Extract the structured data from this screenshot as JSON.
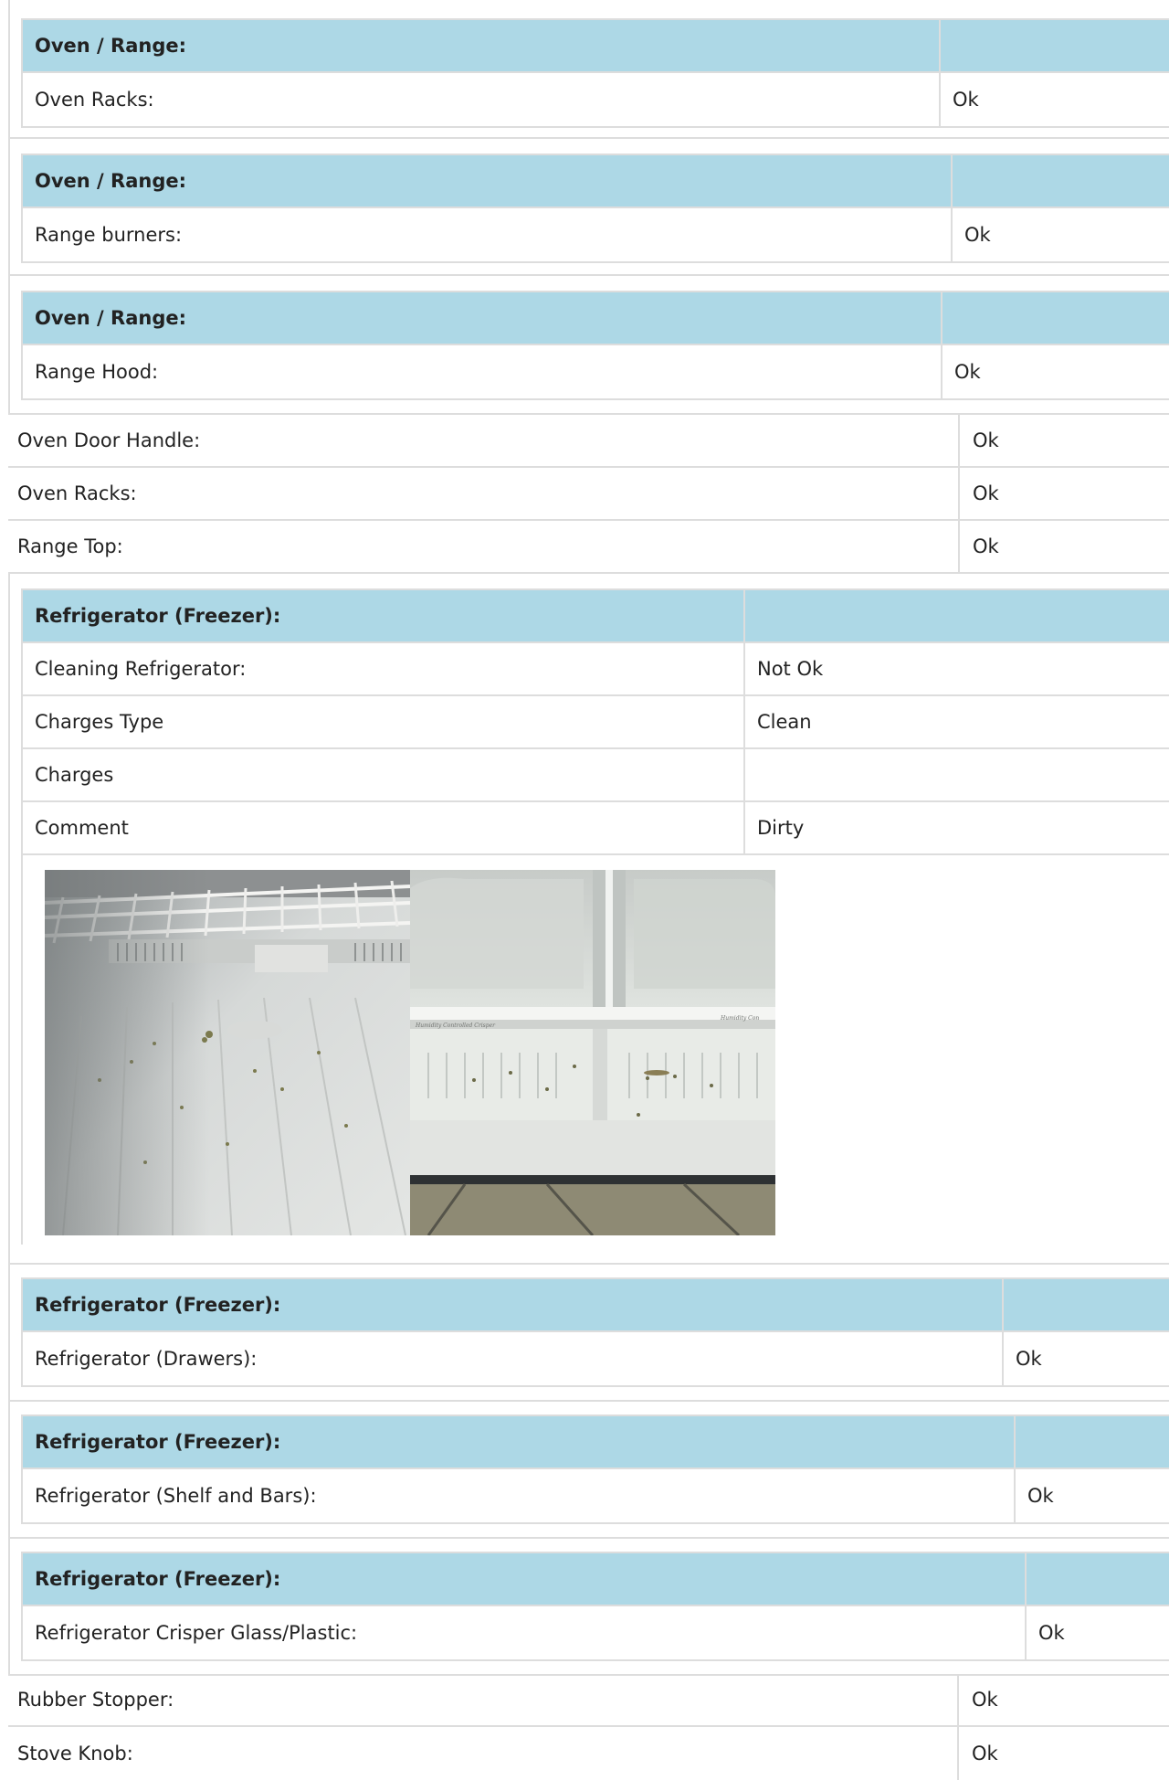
{
  "sections": [
    {
      "header": "Oven / Range:",
      "label": "Oven Racks:",
      "value": "Ok"
    },
    {
      "header": "Oven / Range:",
      "label": "Range burners:",
      "value": "Ok"
    },
    {
      "header": "Oven / Range:",
      "label": "Range Hood:",
      "value": "Ok"
    }
  ],
  "plain_rows_1": [
    {
      "label": "Oven Door Handle:",
      "value": "Ok"
    },
    {
      "label": "Oven Racks:",
      "value": "Ok"
    },
    {
      "label": "Range Top:",
      "value": "Ok"
    }
  ],
  "refrigerator_detail": {
    "header": "Refrigerator (Freezer):",
    "rows": [
      {
        "label": "Cleaning Refrigerator:",
        "value": "Not Ok"
      },
      {
        "label": "Charges Type",
        "value": "Clean"
      },
      {
        "label": "Charges",
        "value": ""
      },
      {
        "label": "Comment",
        "value": "Dirty"
      }
    ],
    "photos": [
      {
        "name": "dirty-freezer-floor-photo"
      },
      {
        "name": "dirty-crisper-drawers-photo",
        "printed_text": "Humidity Controlled Crisper"
      }
    ]
  },
  "sections_2": [
    {
      "header": "Refrigerator (Freezer):",
      "label": "Refrigerator (Drawers):",
      "value": "Ok"
    },
    {
      "header": "Refrigerator (Freezer):",
      "label": "Refrigerator (Shelf and Bars):",
      "value": "Ok"
    },
    {
      "header": "Refrigerator (Freezer):",
      "label": "Refrigerator Crisper Glass/Plastic:",
      "value": "Ok"
    }
  ],
  "plain_rows_2": [
    {
      "label": "Rubber Stopper:",
      "value": "Ok"
    },
    {
      "label": "Stove Knob:",
      "value": "Ok"
    }
  ],
  "colors": {
    "header_background": "#add8e6",
    "border": "#dddddd"
  }
}
